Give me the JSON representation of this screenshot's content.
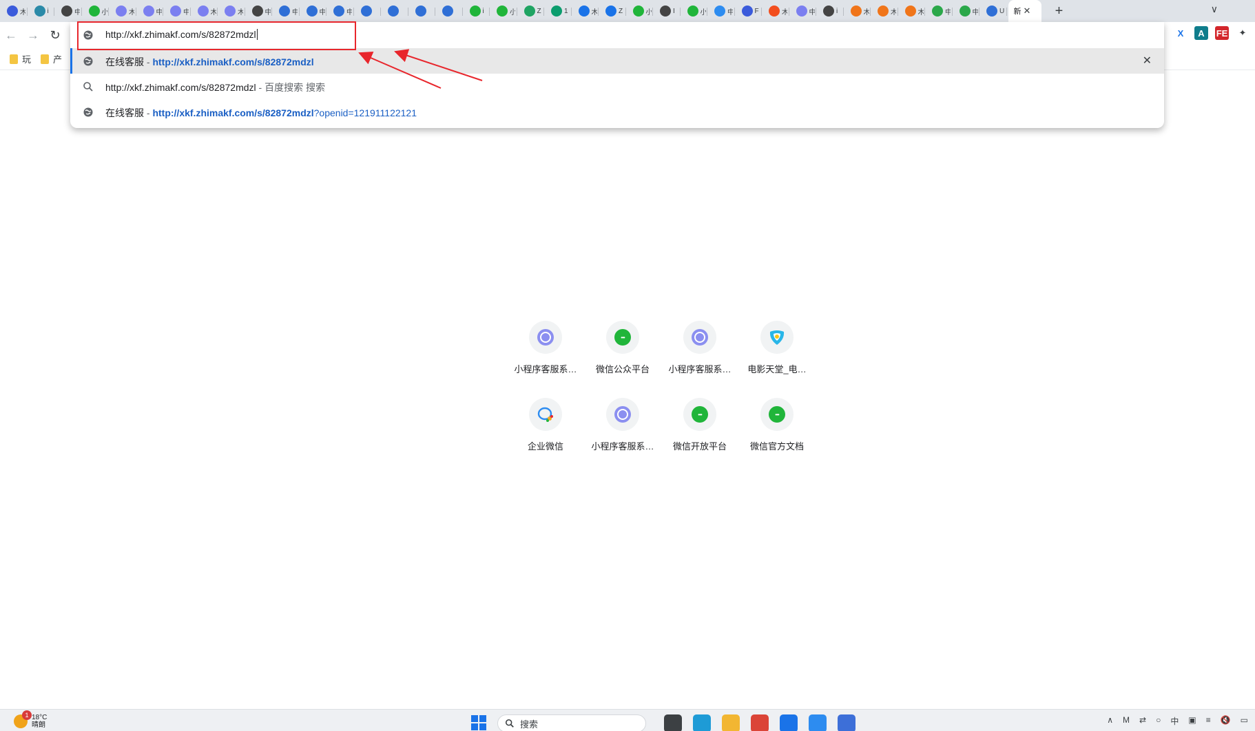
{
  "tabs": {
    "mini_tabs": [
      {
        "icon": "agent-icon",
        "color": "#3b5bdb",
        "text": "木"
      },
      {
        "icon": "bird-icon",
        "color": "#2b8aa8",
        "text": "i"
      },
      {
        "icon": "globe-icon",
        "color": "#444444",
        "text": "中"
      },
      {
        "icon": "wechat-icon",
        "color": "#20b53a",
        "text": "小"
      },
      {
        "icon": "halo-icon",
        "color": "#7b7ff0",
        "text": "木"
      },
      {
        "icon": "halo-icon",
        "color": "#7b7ff0",
        "text": "中"
      },
      {
        "icon": "halo-icon",
        "color": "#7b7ff0",
        "text": "中"
      },
      {
        "icon": "halo-icon",
        "color": "#7b7ff0",
        "text": "木"
      },
      {
        "icon": "halo-icon",
        "color": "#7b7ff0",
        "text": "木"
      },
      {
        "icon": "globe-icon",
        "color": "#444444",
        "text": "中"
      },
      {
        "icon": "box-icon",
        "color": "#2f6fd6",
        "text": "中"
      },
      {
        "icon": "box-icon",
        "color": "#2f6fd6",
        "text": "中"
      },
      {
        "icon": "box-icon",
        "color": "#2f6fd6",
        "text": "中"
      },
      {
        "icon": "box-icon",
        "color": "#2f6fd6",
        "text": ""
      },
      {
        "icon": "box-icon",
        "color": "#2f6fd6",
        "text": ""
      },
      {
        "icon": "box-icon",
        "color": "#2f6fd6",
        "text": ""
      },
      {
        "icon": "box-icon",
        "color": "#2f6fd6",
        "text": ""
      },
      {
        "icon": "wechat-icon",
        "color": "#20b53a",
        "text": "i"
      },
      {
        "icon": "wechat-icon",
        "color": "#20b53a",
        "text": "小"
      },
      {
        "icon": "sheet-icon",
        "color": "#1fa463",
        "text": "Z"
      },
      {
        "icon": "play-icon",
        "color": "#0b9d6e",
        "text": "1"
      },
      {
        "icon": "doc-icon",
        "color": "#1a73e8",
        "text": "木"
      },
      {
        "icon": "doc-icon",
        "color": "#1a73e8",
        "text": "Z"
      },
      {
        "icon": "wechat-icon",
        "color": "#20b53a",
        "text": "小"
      },
      {
        "icon": "globe-icon",
        "color": "#444444",
        "text": "I"
      },
      {
        "icon": "wechat-icon",
        "color": "#20b53a",
        "text": "小"
      },
      {
        "icon": "qiwei-icon",
        "color": "#2d8cf0",
        "text": "中"
      },
      {
        "icon": "agent-icon",
        "color": "#3b5bdb",
        "text": "F"
      },
      {
        "icon": "figma-icon",
        "color": "#f24e1e",
        "text": "木"
      },
      {
        "icon": "halo-icon",
        "color": "#7b7ff0",
        "text": "中"
      },
      {
        "icon": "globe-icon",
        "color": "#444444",
        "text": "i"
      },
      {
        "icon": "code-icon",
        "color": "#f0751a",
        "text": "木"
      },
      {
        "icon": "code-icon",
        "color": "#f0751a",
        "text": "木"
      },
      {
        "icon": "code-icon",
        "color": "#f0751a",
        "text": "木"
      },
      {
        "icon": "ghost-icon",
        "color": "#2ba84a",
        "text": "中"
      },
      {
        "icon": "ghost-icon",
        "color": "#2ba84a",
        "text": "中"
      },
      {
        "icon": "map-icon",
        "color": "#2f6fd6",
        "text": "U"
      }
    ],
    "active_tab": {
      "text": "新",
      "close": "✕"
    },
    "new_tab": "+",
    "tab_search": "∨"
  },
  "toolbar": {
    "back": "←",
    "forward": "→",
    "reload": "↻",
    "extensions": [
      {
        "name": "x-extension",
        "label": "X",
        "color": "#1a73e8",
        "bg": "#ffffff"
      },
      {
        "name": "translate-extension",
        "label": "A",
        "color": "#ffffff",
        "bg": "#0f7d8c"
      },
      {
        "name": "fe-extension",
        "label": "FE",
        "color": "#ffffff",
        "bg": "#d3262b"
      },
      {
        "name": "puzzle-extension",
        "label": "✦",
        "color": "#3c4043",
        "bg": "#ffffff"
      }
    ]
  },
  "bookmarks": [
    {
      "label": "玩"
    },
    {
      "label": "产"
    }
  ],
  "omnibox": {
    "input_text": "http://xkf.zhimakf.com/s/82872mdzl",
    "suggestions": [
      {
        "icon": "globe-icon",
        "desc": "在线客服",
        "sep": " - ",
        "url_bold": "http://xkf.zhimakf.com/s/82872mdzl",
        "url_rest": "",
        "selected": true,
        "remove": "✕"
      },
      {
        "icon": "search-icon",
        "desc": "http://xkf.zhimakf.com/s/82872mdzl",
        "sep": " - ",
        "url_bold": "",
        "url_rest": "",
        "gray": "百度搜索 搜索",
        "selected": false
      },
      {
        "icon": "globe-icon",
        "desc": "在线客服",
        "sep": " - ",
        "url_bold": "http://xkf.zhimakf.com/s/82872mdzl",
        "url_rest": "?openid=121911122121",
        "selected": false
      }
    ]
  },
  "shortcuts": [
    {
      "label": "小程序客服系…",
      "icon": "halo-icon"
    },
    {
      "label": "微信公众平台",
      "icon": "wechat-icon"
    },
    {
      "label": "小程序客服系…",
      "icon": "halo-icon"
    },
    {
      "label": "电影天堂_电…",
      "icon": "movie-icon"
    },
    {
      "label": "企业微信",
      "icon": "qiwei-icon"
    },
    {
      "label": "小程序客服系…",
      "icon": "halo-icon"
    },
    {
      "label": "微信开放平台",
      "icon": "wechat-icon"
    },
    {
      "label": "微信官方文档",
      "icon": "wechat-icon"
    }
  ],
  "taskbar": {
    "weather_temp": "18°C",
    "weather_desc": "晴朗",
    "weather_badge": "1",
    "search_placeholder": "搜索",
    "apps": [
      {
        "name": "task-view-icon",
        "color": "#3c4043"
      },
      {
        "name": "edge-icon",
        "color": "#1e9bd6"
      },
      {
        "name": "file-explorer-icon",
        "color": "#f2b632"
      },
      {
        "name": "chrome-icon",
        "color": "#db4437"
      },
      {
        "name": "feishu-icon",
        "color": "#1a73e8"
      },
      {
        "name": "qiwei-icon",
        "color": "#2d8cf0"
      },
      {
        "name": "xmind-icon",
        "color": "#3d6fd8"
      }
    ],
    "tray": [
      "∧",
      "M",
      "⇄",
      "○",
      "中",
      "▣",
      "≡",
      "🔇",
      "▭"
    ]
  },
  "annotation": {
    "box_color": "#e8262c"
  }
}
